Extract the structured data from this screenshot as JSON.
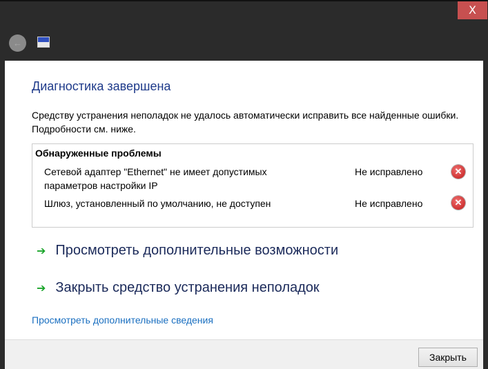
{
  "window": {
    "close_glyph": "X"
  },
  "main": {
    "heading": "Диагностика завершена",
    "description": "Средству устранения неполадок не удалось автоматически исправить все найденные ошибки. Подробности см. ниже.",
    "problems_title": "Обнаруженные проблемы",
    "problems": [
      {
        "text": "Сетевой адаптер \"Ethernet\" не имеет допустимых параметров настройки IP",
        "status": "Не исправлено"
      },
      {
        "text": "Шлюз, установленный по умолчанию, не доступен",
        "status": "Не исправлено"
      }
    ],
    "actions": [
      "Просмотреть дополнительные возможности",
      "Закрыть средство устранения неполадок"
    ],
    "details_link": "Просмотреть дополнительные сведения"
  },
  "footer": {
    "close_label": "Закрыть"
  }
}
